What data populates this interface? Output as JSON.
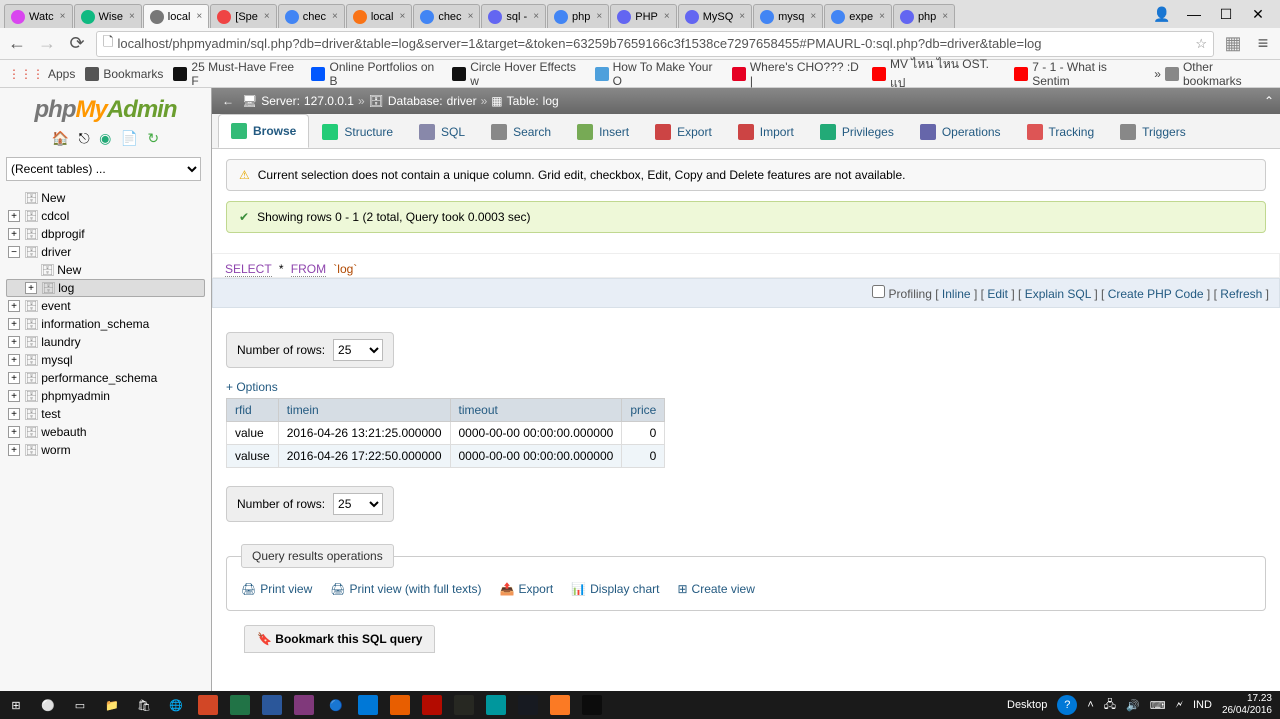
{
  "browser": {
    "tabs": [
      {
        "label": "Watc",
        "color": "#d946ef"
      },
      {
        "label": "Wise",
        "color": "#10b981"
      },
      {
        "label": "local",
        "color": "#777",
        "active": true
      },
      {
        "label": "[Spe",
        "color": "#ef4444"
      },
      {
        "label": "chec",
        "color": "#4285f4"
      },
      {
        "label": "local",
        "color": "#f97316"
      },
      {
        "label": "chec",
        "color": "#4285f4"
      },
      {
        "label": "sql -",
        "color": "#6366f1"
      },
      {
        "label": "php",
        "color": "#4285f4"
      },
      {
        "label": "PHP",
        "color": "#6366f1"
      },
      {
        "label": "MySQ",
        "color": "#6366f1"
      },
      {
        "label": "mysq",
        "color": "#4285f4"
      },
      {
        "label": "expe",
        "color": "#4285f4"
      },
      {
        "label": "php",
        "color": "#6366f1"
      }
    ],
    "url": "localhost/phpmyadmin/sql.php?db=driver&table=log&server=1&target=&token=63259b7659166c3f1538ce7297658455#PMAURL-0:sql.php?db=driver&table=log",
    "bookmarks": {
      "apps": "Apps",
      "items": [
        {
          "label": "Bookmarks",
          "bg": "#555"
        },
        {
          "label": "25 Must-Have Free F",
          "bg": "#111"
        },
        {
          "label": "Online Portfolios on B",
          "bg": "#0057ff"
        },
        {
          "label": "Circle Hover Effects w",
          "bg": "#111"
        },
        {
          "label": "How To Make Your O",
          "bg": "#4ea0dc"
        },
        {
          "label": "Where's CHO??? :D |",
          "bg": "#e60023"
        },
        {
          "label": "MV ไหน ไหน OST. แป",
          "bg": "#f00"
        },
        {
          "label": "7 - 1 - What is Sentim",
          "bg": "#f00"
        }
      ],
      "other": "Other bookmarks"
    }
  },
  "sidebar": {
    "recent": "(Recent tables) ...",
    "tree": [
      {
        "label": "New",
        "level": 1,
        "plus": false
      },
      {
        "label": "cdcol",
        "level": 1,
        "plus": true
      },
      {
        "label": "dbprogif",
        "level": 1,
        "plus": true
      },
      {
        "label": "driver",
        "level": 1,
        "plus": true,
        "open": true
      },
      {
        "label": "New",
        "level": 2,
        "plus": false
      },
      {
        "label": "log",
        "level": 2,
        "plus": true,
        "sel": true
      },
      {
        "label": "event",
        "level": 1,
        "plus": true
      },
      {
        "label": "information_schema",
        "level": 1,
        "plus": true
      },
      {
        "label": "laundry",
        "level": 1,
        "plus": true
      },
      {
        "label": "mysql",
        "level": 1,
        "plus": true
      },
      {
        "label": "performance_schema",
        "level": 1,
        "plus": true
      },
      {
        "label": "phpmyadmin",
        "level": 1,
        "plus": true
      },
      {
        "label": "test",
        "level": 1,
        "plus": true
      },
      {
        "label": "webauth",
        "level": 1,
        "plus": true
      },
      {
        "label": "worm",
        "level": 1,
        "plus": true
      }
    ]
  },
  "crumb": {
    "server_label": "Server:",
    "server": "127.0.0.1",
    "db_label": "Database:",
    "db": "driver",
    "table_label": "Table:",
    "table": "log"
  },
  "tabs": [
    {
      "label": "Browse",
      "active": true,
      "color": "#3b7"
    },
    {
      "label": "Structure",
      "color": "#2c7"
    },
    {
      "label": "SQL",
      "color": "#88a"
    },
    {
      "label": "Search",
      "color": "#888"
    },
    {
      "label": "Insert",
      "color": "#7a5"
    },
    {
      "label": "Export",
      "color": "#c44"
    },
    {
      "label": "Import",
      "color": "#c44"
    },
    {
      "label": "Privileges",
      "color": "#2a7"
    },
    {
      "label": "Operations",
      "color": "#66a"
    },
    {
      "label": "Tracking",
      "color": "#d55"
    },
    {
      "label": "Triggers",
      "color": "#888"
    }
  ],
  "msg": {
    "warn": "Current selection does not contain a unique column. Grid edit, checkbox, Edit, Copy and Delete features are not available.",
    "ok": "Showing rows 0 - 1 (2 total, Query took 0.0003 sec)"
  },
  "sql": {
    "select": "SELECT",
    "star": "*",
    "from": "FROM",
    "table": "`log`"
  },
  "linkbar": {
    "profiling": "Profiling",
    "links": [
      "Inline",
      "Edit",
      "Explain SQL",
      "Create PHP Code",
      "Refresh"
    ]
  },
  "rows": {
    "label": "Number of rows:",
    "value": "25"
  },
  "options": "+ Options",
  "table": {
    "cols": [
      "rfid",
      "timein",
      "timeout",
      "price"
    ],
    "rows": [
      [
        "value",
        "2016-04-26 13:21:25.000000",
        "0000-00-00 00:00:00.000000",
        "0"
      ],
      [
        "valuse",
        "2016-04-26 17:22:50.000000",
        "0000-00-00 00:00:00.000000",
        "0"
      ]
    ]
  },
  "qro": {
    "legend": "Query results operations",
    "ops": [
      "Print view",
      "Print view (with full texts)",
      "Export",
      "Display chart",
      "Create view"
    ]
  },
  "bookmark": "Bookmark this SQL query",
  "taskbar": {
    "desktop": "Desktop",
    "lang": "IND",
    "time": "17.23",
    "date": "26/04/2016"
  }
}
